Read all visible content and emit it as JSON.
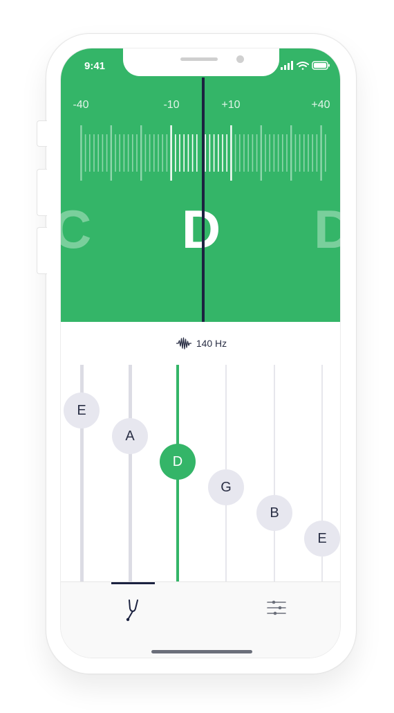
{
  "status_bar": {
    "time": "9:41"
  },
  "tuner": {
    "scale_labels": [
      {
        "text": "-40"
      },
      {
        "text": "-10"
      },
      {
        "text": "+10"
      },
      {
        "text": "+40"
      }
    ],
    "current_note": "D",
    "prev_note": "C",
    "next_note": "D"
  },
  "frequency": {
    "value": "140 Hz",
    "icon": "waveform-icon"
  },
  "strings": [
    {
      "label": "E",
      "active": false
    },
    {
      "label": "A",
      "active": false
    },
    {
      "label": "D",
      "active": true
    },
    {
      "label": "G",
      "active": false
    },
    {
      "label": "B",
      "active": false
    },
    {
      "label": "E",
      "active": false
    }
  ],
  "tab_bar": {
    "tabs": [
      {
        "icon": "tuning-fork-icon",
        "selected": true
      },
      {
        "icon": "sliders-icon",
        "selected": false
      }
    ]
  },
  "colors": {
    "accent": "#34b568",
    "dark": "#1c2240",
    "peg": "#e7e7ef"
  }
}
